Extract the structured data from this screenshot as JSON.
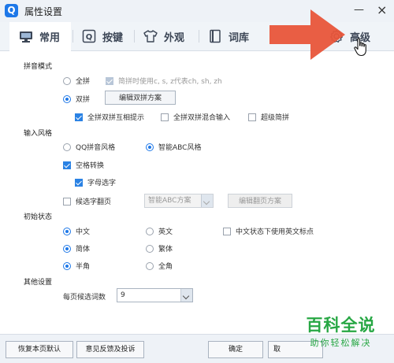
{
  "window": {
    "title": "属性设置",
    "app_icon_letter": "Q",
    "minimize_glyph": "—",
    "close_glyph": "×"
  },
  "tabs": [
    {
      "label": "常用",
      "icon": "monitor-icon",
      "active": true
    },
    {
      "label": "按键",
      "icon": "key-icon",
      "active": false
    },
    {
      "label": "外观",
      "icon": "shirt-icon",
      "active": false
    },
    {
      "label": "词库",
      "icon": "book-icon",
      "active": false
    },
    {
      "label": "高级",
      "icon": "gear-icon",
      "active": false
    }
  ],
  "pinyin": {
    "section_title": "拼音模式",
    "quanpin_label": "全拼",
    "quanpin_jianpin_label": "简拼时使用c, s, z代表ch, sh, zh",
    "shuangpin_label": "双拼",
    "edit_shuangpin_button": "编辑双拼方案",
    "hint_label": "全拼双拼互相提示",
    "mixed_label": "全拼双拼混合输入",
    "super_jianpin_label": "超级简拼"
  },
  "style": {
    "section_title": "输入风格",
    "qq_style_label": "QQ拼音风格",
    "abc_style_label": "智能ABC风格",
    "space_convert_label": "空格转换",
    "letter_select_label": "字母选字",
    "candidate_page_label": "候选字翻页",
    "scheme_select_value": "智能ABC方案",
    "edit_page_button": "编辑翻页方案"
  },
  "init": {
    "section_title": "初始状态",
    "chinese_label": "中文",
    "english_label": "英文",
    "english_punct_label": "中文状态下使用英文标点",
    "simplified_label": "简体",
    "traditional_label": "繁体",
    "half_width_label": "半角",
    "full_width_label": "全角"
  },
  "other": {
    "section_title": "其他设置",
    "per_page_label": "每页候选词数",
    "per_page_value": "9"
  },
  "footer": {
    "restore_button": "恢复本页默认",
    "feedback_button": "意见反馈及投诉",
    "ok_button": "确定",
    "cancel_button": "取"
  },
  "watermark": {
    "title": "百科全说",
    "subtitle": "助你轻松解决"
  },
  "colors": {
    "accent_blue": "#1e78e8",
    "arrow_red": "#e8553a",
    "watermark_green": "#27a744"
  }
}
